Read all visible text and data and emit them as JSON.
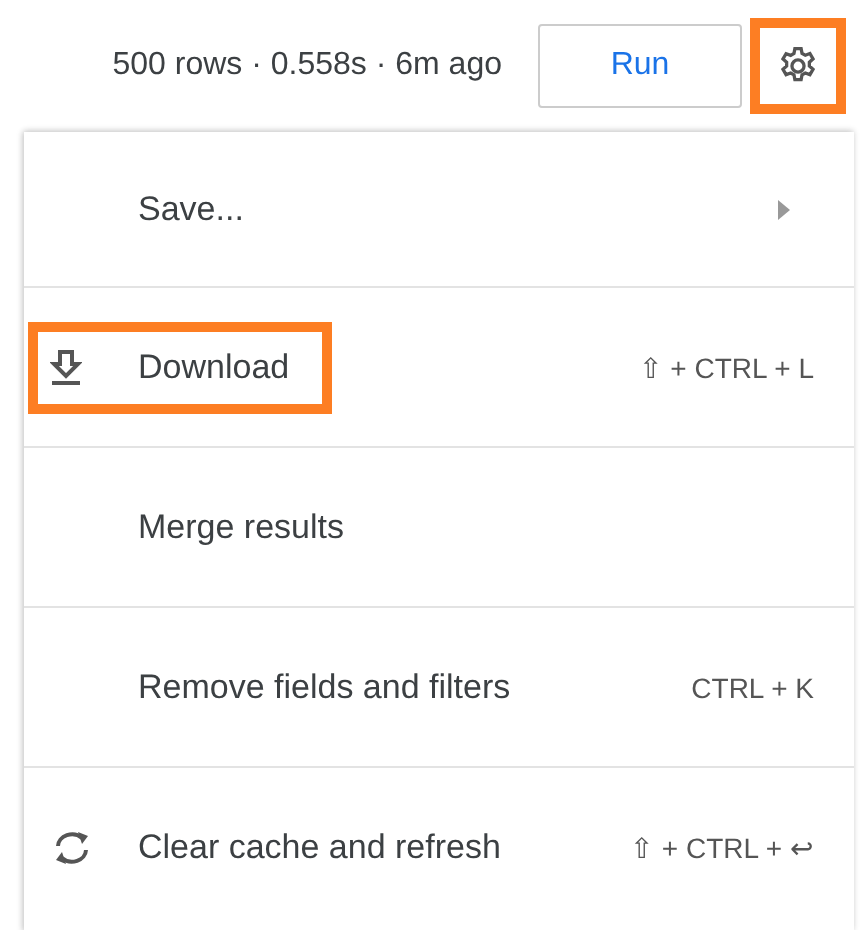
{
  "status": "500 rows · 0.558s · 6m ago",
  "run_button": "Run",
  "settings_button": {
    "highlighted": true
  },
  "menu": [
    {
      "kind": "submenu",
      "label": "Save...",
      "highlighted": false
    },
    {
      "kind": "download",
      "label": "Download",
      "shortcut": "⇧ + CTRL + L",
      "highlighted": true
    },
    {
      "kind": "plain",
      "label": "Merge results",
      "highlighted": false
    },
    {
      "kind": "plain",
      "label": "Remove fields and filters",
      "shortcut": "CTRL + K",
      "highlighted": false
    },
    {
      "kind": "refresh",
      "label": "Clear cache and refresh",
      "shortcut": "⇧ + CTRL + ↩",
      "highlighted": false
    }
  ]
}
